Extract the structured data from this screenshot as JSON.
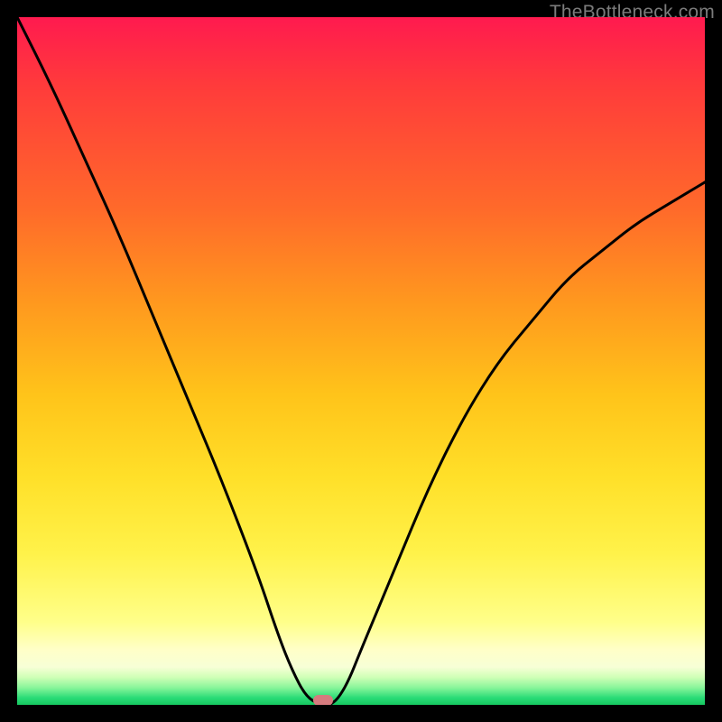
{
  "watermark": "TheBottleneck.com",
  "colors": {
    "grad_top": "#ff1a4f",
    "grad_mid": "#ffd427",
    "grad_bottom": "#16c75f",
    "curve": "#000000",
    "marker": "#d67b7e",
    "frame": "#000000"
  },
  "chart_data": {
    "type": "line",
    "title": "",
    "xlabel": "",
    "ylabel": "",
    "xlim": [
      0,
      100
    ],
    "ylim": [
      0,
      100
    ],
    "grid": false,
    "legend": false,
    "annotations": [],
    "series": [
      {
        "name": "curve",
        "x": [
          0,
          5,
          10,
          15,
          20,
          25,
          30,
          35,
          38,
          40,
          42,
          44,
          46,
          48,
          50,
          55,
          60,
          65,
          70,
          75,
          80,
          85,
          90,
          95,
          100
        ],
        "values": [
          100,
          90,
          79,
          68,
          56,
          44,
          32,
          19,
          10,
          5,
          1.2,
          0,
          0,
          3,
          8,
          20,
          32,
          42,
          50,
          56,
          62,
          66,
          70,
          73,
          76
        ]
      }
    ],
    "marker": {
      "x": 44.5,
      "y": 0
    }
  }
}
